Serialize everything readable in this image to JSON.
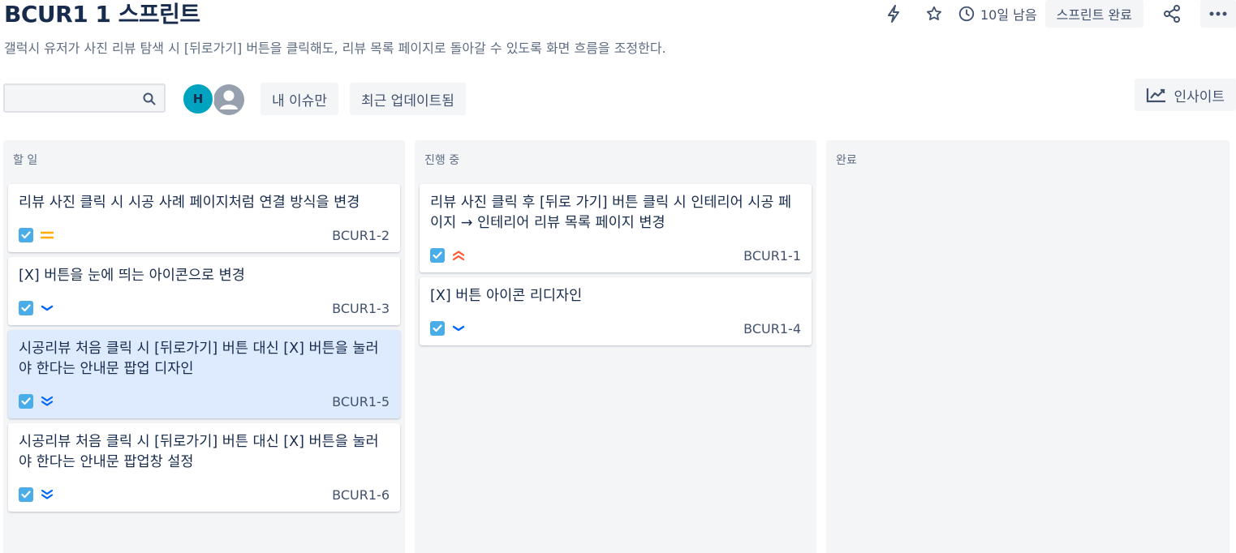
{
  "header": {
    "title": "BCUR1 1 스프린트",
    "subtitle": "갤럭시 유저가 사진 리뷰 탐색 시 [뒤로가기] 버튼을 클릭해도, 리뷰 목록 페이지로 돌아갈 수 있도록 화면 흐름을 조정한다.",
    "days_left": "10일 남음",
    "complete_sprint": "스프린트 완료",
    "icons": [
      "lightning-icon",
      "star-icon",
      "clock-icon",
      "share-icon",
      "more-icon"
    ]
  },
  "filters": {
    "search_placeholder": "",
    "avatar_initial": "H",
    "avatar_color": "#00a3bf",
    "my_issues": "내 이슈만",
    "recently_updated": "최근 업데이트됨",
    "insights": "인사이트"
  },
  "columns": [
    {
      "name": "할 일",
      "cards": [
        {
          "summary": "리뷰 사진 클릭 시 시공 사례 페이지처럼 연결 방식을 변경",
          "key": "BCUR1-2",
          "priority": "medium"
        },
        {
          "summary": "[X] 버튼을 눈에 띄는 아이콘으로 변경",
          "key": "BCUR1-3",
          "priority": "low"
        },
        {
          "summary": "시공리뷰 처음 클릭 시 [뒤로가기] 버튼 대신 [X] 버튼을 눌러야 한다는 안내문 팝업 디자인",
          "key": "BCUR1-5",
          "priority": "lowest",
          "selected": true
        },
        {
          "summary": "시공리뷰 처음 클릭 시 [뒤로가기] 버튼 대신 [X] 버튼을 눌러야 한다는 안내문 팝업창 설정",
          "key": "BCUR1-6",
          "priority": "lowest"
        }
      ]
    },
    {
      "name": "진행 중",
      "cards": [
        {
          "summary": "리뷰 사진 클릭 후 [뒤로 가기] 버튼 클릭 시 인테리어 시공 페이지 → 인테리어 리뷰 목록 페이지 변경",
          "key": "BCUR1-1",
          "priority": "highest"
        },
        {
          "summary": "[X] 버튼 아이콘 리디자인",
          "key": "BCUR1-4",
          "priority": "low"
        }
      ]
    },
    {
      "name": "완료",
      "cards": []
    }
  ],
  "colors": {
    "accent": "#0052cc",
    "checkbox": "#4bade8",
    "priority_medium": "#ffab00",
    "priority_highest": "#ff5630",
    "priority_low": "#0065ff",
    "selected_card": "#deebff"
  }
}
